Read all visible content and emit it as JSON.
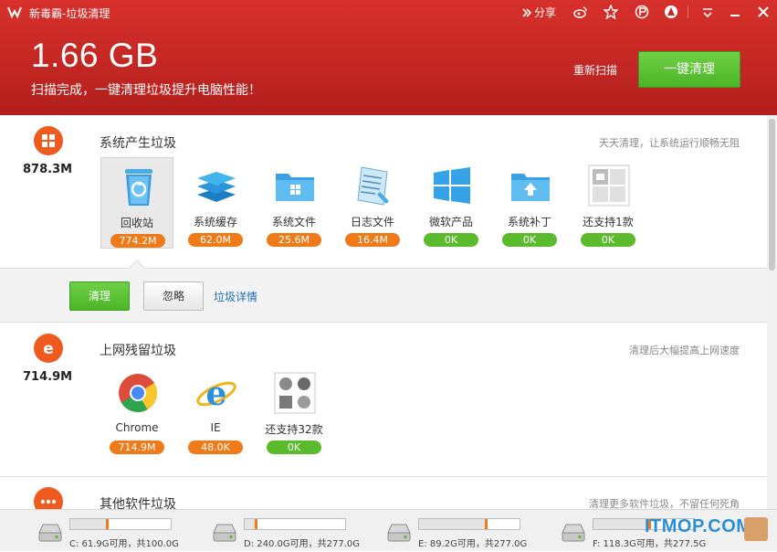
{
  "app": {
    "title": "新毒霸-垃圾清理",
    "share_label": "分享",
    "icons": [
      "share-arrow-icon",
      "weibo-icon",
      "star-icon",
      "pin-icon",
      "mode-icon",
      "menu-icon",
      "minimize-icon",
      "close-icon"
    ]
  },
  "header": {
    "total_size": "1.66 GB",
    "message": "扫描完成，一键清理垃圾提升电脑性能！",
    "rescan_label": "重新扫描",
    "clean_all_label": "一键清理"
  },
  "sections": [
    {
      "size": "878.3M",
      "title": "系统产生垃圾",
      "hint": "天天清理，让系统运行顺畅无阻",
      "icon": "windows-icon",
      "items": [
        {
          "label": "回收站",
          "value": "774.2M",
          "status": "orange",
          "icon": "recycle-bin-icon"
        },
        {
          "label": "系统缓存",
          "value": "62.0M",
          "status": "orange",
          "icon": "layers-icon"
        },
        {
          "label": "系统文件",
          "value": "25.6M",
          "status": "orange",
          "icon": "folder-windows-icon"
        },
        {
          "label": "日志文件",
          "value": "16.4M",
          "status": "orange",
          "icon": "log-file-icon"
        },
        {
          "label": "微软产品",
          "value": "0K",
          "status": "green",
          "icon": "microsoft-icon"
        },
        {
          "label": "系统补丁",
          "value": "0K",
          "status": "green",
          "icon": "folder-upload-icon"
        },
        {
          "label": "还支持1款",
          "value": "0K",
          "status": "green",
          "icon": "more-apps-icon"
        }
      ],
      "actions": {
        "clean": "清理",
        "ignore": "忽略",
        "detail": "垃圾详情"
      }
    },
    {
      "size": "714.9M",
      "title": "上网残留垃圾",
      "hint": "清理后大幅提高上网速度",
      "icon": "browser-e-icon",
      "items": [
        {
          "label": "Chrome",
          "value": "714.9M",
          "status": "orange",
          "icon": "chrome-icon"
        },
        {
          "label": "IE",
          "value": "48.0K",
          "status": "orange",
          "icon": "ie-icon"
        },
        {
          "label": "还支持32款",
          "value": "0K",
          "status": "green",
          "icon": "more-browsers-icon"
        }
      ]
    },
    {
      "title": "其他软件垃圾",
      "hint": "清理更多软件垃圾，不留任何死角",
      "icon": "more-dots-icon"
    }
  ],
  "drives": [
    {
      "text": "C: 61.9G可用，共100.0G",
      "used_fraction": 0.38
    },
    {
      "text": "D: 240.0G可用，共277.0G",
      "used_fraction": 0.13
    },
    {
      "text": "E: 89.2G可用，共277.0G",
      "used_fraction": 0.68
    },
    {
      "text": "F: 118.3G可用，共277.5G",
      "used_fraction": 0.57
    }
  ],
  "watermark": "ITMOP.COM",
  "colors": {
    "header_red": "#c42723",
    "green": "#5bbb2c",
    "orange": "#ef7a1a",
    "link": "#1b6fb8"
  }
}
